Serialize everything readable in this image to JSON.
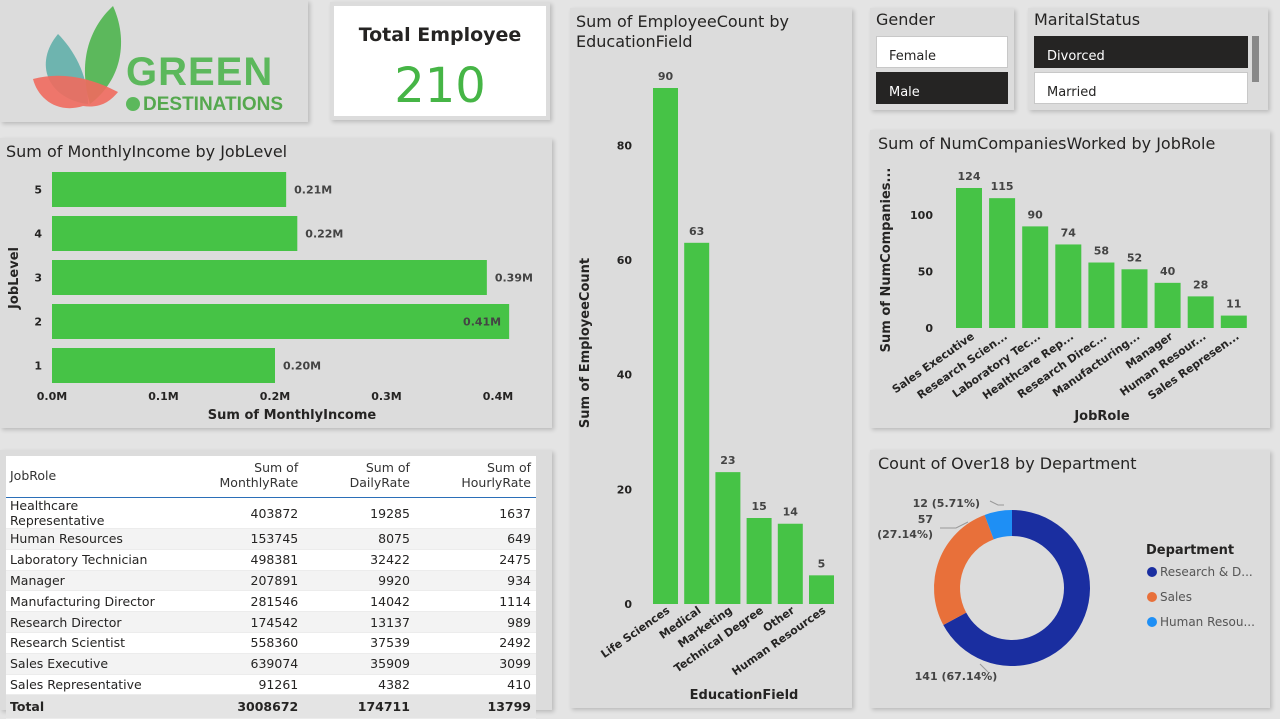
{
  "logo": {
    "line1": "GREEN",
    "line2": "DESTINATIONS"
  },
  "kpi": {
    "title": "Total Employee",
    "value": "210"
  },
  "slicers": {
    "gender": {
      "title": "Gender",
      "items": [
        {
          "label": "Female",
          "selected": false
        },
        {
          "label": "Male",
          "selected": true
        }
      ]
    },
    "marital": {
      "title": "MaritalStatus",
      "items": [
        {
          "label": "Divorced",
          "selected": true
        },
        {
          "label": "Married",
          "selected": false
        }
      ]
    }
  },
  "colors": {
    "bar": "#46c346",
    "donut": [
      "#1a2ea0",
      "#e8703a",
      "#1e8ff5"
    ]
  },
  "charts": {
    "income": {
      "title": "Sum of MonthlyIncome by JobLevel"
    },
    "education": {
      "title_line1": "Sum of EmployeeCount by",
      "title_line2": "EducationField"
    },
    "companies": {
      "title": "Sum of NumCompaniesWorked by JobRole"
    },
    "dept": {
      "title": "Count of Over18 by Department"
    }
  },
  "chart_data": [
    {
      "type": "bar",
      "orientation": "horizontal",
      "title": "Sum of MonthlyIncome by JobLevel",
      "categories": [
        "5",
        "4",
        "3",
        "2",
        "1"
      ],
      "values": [
        0.21,
        0.22,
        0.39,
        0.41,
        0.2
      ],
      "labels": [
        "0.21M",
        "0.22M",
        "0.39M",
        "0.41M",
        "0.20M"
      ],
      "xlabel": "Sum of MonthlyIncome",
      "ylabel": "JobLevel",
      "xticks": [
        "0.0M",
        "0.1M",
        "0.2M",
        "0.3M",
        "0.4M"
      ],
      "xlim": [
        0,
        0.4
      ]
    },
    {
      "type": "bar",
      "title": "Sum of EmployeeCount by EducationField",
      "categories": [
        "Life Sciences",
        "Medical",
        "Marketing",
        "Technical Degree",
        "Other",
        "Human Resources"
      ],
      "values": [
        90,
        63,
        23,
        15,
        14,
        5
      ],
      "xlabel": "EducationField",
      "ylabel": "Sum of EmployeeCount",
      "yticks": [
        0,
        20,
        40,
        60,
        80
      ],
      "ylim": [
        0,
        90
      ]
    },
    {
      "type": "bar",
      "title": "Sum of NumCompaniesWorked by JobRole",
      "categories": [
        "Sales Executive",
        "Research Scien...",
        "Laboratory Tec...",
        "Healthcare Rep...",
        "Research Direc...",
        "Manufacturing...",
        "Manager",
        "Human Resour...",
        "Sales Represen..."
      ],
      "values": [
        124,
        115,
        90,
        74,
        58,
        52,
        40,
        28,
        11
      ],
      "xlabel": "JobRole",
      "ylabel": "Sum of NumCompanies...",
      "yticks": [
        0,
        50,
        100
      ],
      "ylim": [
        0,
        124
      ]
    },
    {
      "type": "pie",
      "variant": "donut",
      "title": "Count of Over18 by Department",
      "legend_title": "Department",
      "categories": [
        "Research & D...",
        "Sales",
        "Human Resou..."
      ],
      "values": [
        141,
        57,
        12
      ],
      "labels": [
        "141 (67.14%)",
        "57",
        "(27.14%)",
        "12 (5.71%)"
      ]
    }
  ],
  "table": {
    "columns": [
      "JobRole",
      "Sum of MonthlyRate",
      "Sum of DailyRate",
      "Sum of HourlyRate"
    ],
    "rows": [
      [
        "Healthcare Representative",
        "403872",
        "19285",
        "1637"
      ],
      [
        "Human Resources",
        "153745",
        "8075",
        "649"
      ],
      [
        "Laboratory Technician",
        "498381",
        "32422",
        "2475"
      ],
      [
        "Manager",
        "207891",
        "9920",
        "934"
      ],
      [
        "Manufacturing Director",
        "281546",
        "14042",
        "1114"
      ],
      [
        "Research Director",
        "174542",
        "13137",
        "989"
      ],
      [
        "Research Scientist",
        "558360",
        "37539",
        "2492"
      ],
      [
        "Sales Executive",
        "639074",
        "35909",
        "3099"
      ],
      [
        "Sales Representative",
        "91261",
        "4382",
        "410"
      ]
    ],
    "total": [
      "Total",
      "3008672",
      "174711",
      "13799"
    ]
  }
}
